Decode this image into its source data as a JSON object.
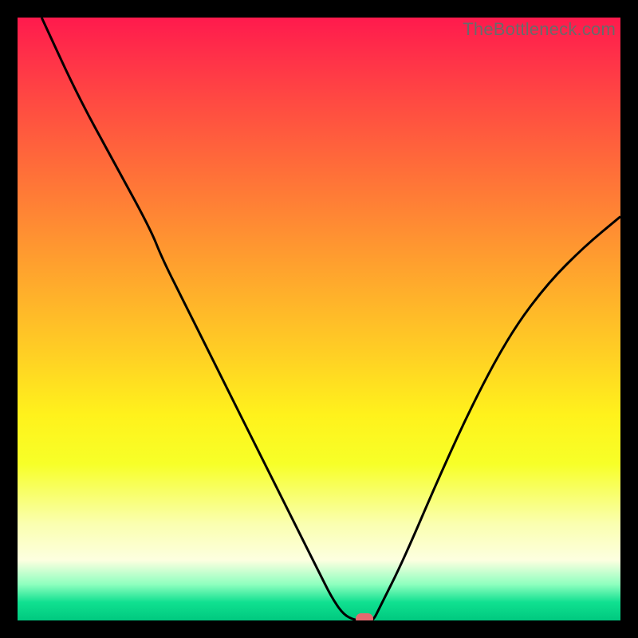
{
  "watermark": "TheBottleneck.com",
  "colors": {
    "background": "#000000",
    "curve_stroke": "#000000",
    "marker_fill": "#e46a6f"
  },
  "chart_data": {
    "type": "line",
    "title": "",
    "xlabel": "",
    "ylabel": "",
    "xlim": [
      0,
      100
    ],
    "ylim": [
      0,
      100
    ],
    "grid": false,
    "legend": false,
    "series": [
      {
        "name": "bottleneck-curve",
        "points_xy": [
          [
            4,
            100
          ],
          [
            10,
            87
          ],
          [
            16,
            76
          ],
          [
            22,
            65
          ],
          [
            24,
            60
          ],
          [
            28,
            52
          ],
          [
            34,
            40
          ],
          [
            40,
            28
          ],
          [
            46,
            16
          ],
          [
            50,
            8
          ],
          [
            52,
            4
          ],
          [
            54,
            1
          ],
          [
            56,
            0
          ],
          [
            58,
            0
          ],
          [
            59,
            0
          ],
          [
            60,
            2
          ],
          [
            64,
            10
          ],
          [
            70,
            24
          ],
          [
            76,
            37
          ],
          [
            82,
            48
          ],
          [
            88,
            56
          ],
          [
            94,
            62
          ],
          [
            100,
            67
          ]
        ]
      }
    ],
    "annotations": [
      {
        "name": "min-marker",
        "x": 57.5,
        "y": 0
      }
    ]
  }
}
